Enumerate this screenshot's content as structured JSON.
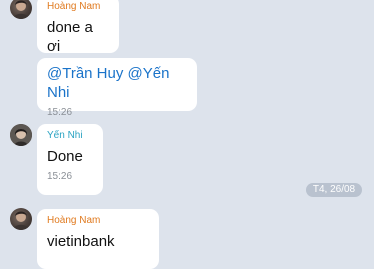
{
  "messages": [
    {
      "sender": "Hoàng Nam",
      "text": "done a ơi"
    },
    {
      "text": "@Trần Huy @Yến Nhi",
      "time": "15:26"
    },
    {
      "sender": "Yến Nhi",
      "text": "Done",
      "time": "15:26"
    },
    {
      "sender": "Hoàng Nam",
      "text": "vietinbank"
    }
  ],
  "date_separator": "T4, 26/08",
  "colors": {
    "background": "#dde3ec",
    "bubble": "#ffffff",
    "sender_hoang_nam": "#e07a1f",
    "sender_yen_nhi": "#2aa3c2",
    "mention": "#1a73c9",
    "timestamp": "#8a8f96",
    "date_pill": "#b9c2cf"
  }
}
